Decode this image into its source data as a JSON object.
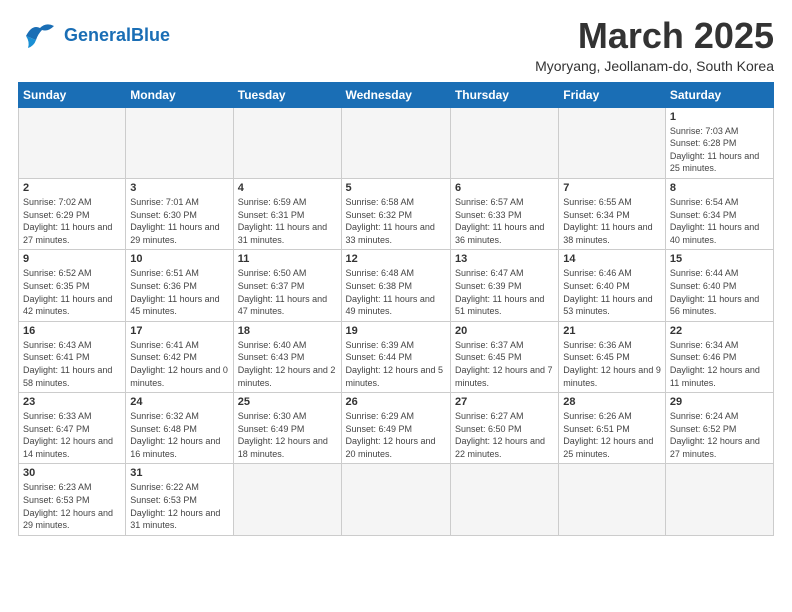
{
  "header": {
    "logo_general": "General",
    "logo_blue": "Blue",
    "month_title": "March 2025",
    "subtitle": "Myoryang, Jeollanam-do, South Korea"
  },
  "weekdays": [
    "Sunday",
    "Monday",
    "Tuesday",
    "Wednesday",
    "Thursday",
    "Friday",
    "Saturday"
  ],
  "weeks": [
    [
      {
        "day": "",
        "info": ""
      },
      {
        "day": "",
        "info": ""
      },
      {
        "day": "",
        "info": ""
      },
      {
        "day": "",
        "info": ""
      },
      {
        "day": "",
        "info": ""
      },
      {
        "day": "",
        "info": ""
      },
      {
        "day": "1",
        "info": "Sunrise: 7:03 AM\nSunset: 6:28 PM\nDaylight: 11 hours and 25 minutes."
      }
    ],
    [
      {
        "day": "2",
        "info": "Sunrise: 7:02 AM\nSunset: 6:29 PM\nDaylight: 11 hours and 27 minutes."
      },
      {
        "day": "3",
        "info": "Sunrise: 7:01 AM\nSunset: 6:30 PM\nDaylight: 11 hours and 29 minutes."
      },
      {
        "day": "4",
        "info": "Sunrise: 6:59 AM\nSunset: 6:31 PM\nDaylight: 11 hours and 31 minutes."
      },
      {
        "day": "5",
        "info": "Sunrise: 6:58 AM\nSunset: 6:32 PM\nDaylight: 11 hours and 33 minutes."
      },
      {
        "day": "6",
        "info": "Sunrise: 6:57 AM\nSunset: 6:33 PM\nDaylight: 11 hours and 36 minutes."
      },
      {
        "day": "7",
        "info": "Sunrise: 6:55 AM\nSunset: 6:34 PM\nDaylight: 11 hours and 38 minutes."
      },
      {
        "day": "8",
        "info": "Sunrise: 6:54 AM\nSunset: 6:34 PM\nDaylight: 11 hours and 40 minutes."
      }
    ],
    [
      {
        "day": "9",
        "info": "Sunrise: 6:52 AM\nSunset: 6:35 PM\nDaylight: 11 hours and 42 minutes."
      },
      {
        "day": "10",
        "info": "Sunrise: 6:51 AM\nSunset: 6:36 PM\nDaylight: 11 hours and 45 minutes."
      },
      {
        "day": "11",
        "info": "Sunrise: 6:50 AM\nSunset: 6:37 PM\nDaylight: 11 hours and 47 minutes."
      },
      {
        "day": "12",
        "info": "Sunrise: 6:48 AM\nSunset: 6:38 PM\nDaylight: 11 hours and 49 minutes."
      },
      {
        "day": "13",
        "info": "Sunrise: 6:47 AM\nSunset: 6:39 PM\nDaylight: 11 hours and 51 minutes."
      },
      {
        "day": "14",
        "info": "Sunrise: 6:46 AM\nSunset: 6:40 PM\nDaylight: 11 hours and 53 minutes."
      },
      {
        "day": "15",
        "info": "Sunrise: 6:44 AM\nSunset: 6:40 PM\nDaylight: 11 hours and 56 minutes."
      }
    ],
    [
      {
        "day": "16",
        "info": "Sunrise: 6:43 AM\nSunset: 6:41 PM\nDaylight: 11 hours and 58 minutes."
      },
      {
        "day": "17",
        "info": "Sunrise: 6:41 AM\nSunset: 6:42 PM\nDaylight: 12 hours and 0 minutes."
      },
      {
        "day": "18",
        "info": "Sunrise: 6:40 AM\nSunset: 6:43 PM\nDaylight: 12 hours and 2 minutes."
      },
      {
        "day": "19",
        "info": "Sunrise: 6:39 AM\nSunset: 6:44 PM\nDaylight: 12 hours and 5 minutes."
      },
      {
        "day": "20",
        "info": "Sunrise: 6:37 AM\nSunset: 6:45 PM\nDaylight: 12 hours and 7 minutes."
      },
      {
        "day": "21",
        "info": "Sunrise: 6:36 AM\nSunset: 6:45 PM\nDaylight: 12 hours and 9 minutes."
      },
      {
        "day": "22",
        "info": "Sunrise: 6:34 AM\nSunset: 6:46 PM\nDaylight: 12 hours and 11 minutes."
      }
    ],
    [
      {
        "day": "23",
        "info": "Sunrise: 6:33 AM\nSunset: 6:47 PM\nDaylight: 12 hours and 14 minutes."
      },
      {
        "day": "24",
        "info": "Sunrise: 6:32 AM\nSunset: 6:48 PM\nDaylight: 12 hours and 16 minutes."
      },
      {
        "day": "25",
        "info": "Sunrise: 6:30 AM\nSunset: 6:49 PM\nDaylight: 12 hours and 18 minutes."
      },
      {
        "day": "26",
        "info": "Sunrise: 6:29 AM\nSunset: 6:49 PM\nDaylight: 12 hours and 20 minutes."
      },
      {
        "day": "27",
        "info": "Sunrise: 6:27 AM\nSunset: 6:50 PM\nDaylight: 12 hours and 22 minutes."
      },
      {
        "day": "28",
        "info": "Sunrise: 6:26 AM\nSunset: 6:51 PM\nDaylight: 12 hours and 25 minutes."
      },
      {
        "day": "29",
        "info": "Sunrise: 6:24 AM\nSunset: 6:52 PM\nDaylight: 12 hours and 27 minutes."
      }
    ],
    [
      {
        "day": "30",
        "info": "Sunrise: 6:23 AM\nSunset: 6:53 PM\nDaylight: 12 hours and 29 minutes."
      },
      {
        "day": "31",
        "info": "Sunrise: 6:22 AM\nSunset: 6:53 PM\nDaylight: 12 hours and 31 minutes."
      },
      {
        "day": "",
        "info": ""
      },
      {
        "day": "",
        "info": ""
      },
      {
        "day": "",
        "info": ""
      },
      {
        "day": "",
        "info": ""
      },
      {
        "day": "",
        "info": ""
      }
    ]
  ]
}
